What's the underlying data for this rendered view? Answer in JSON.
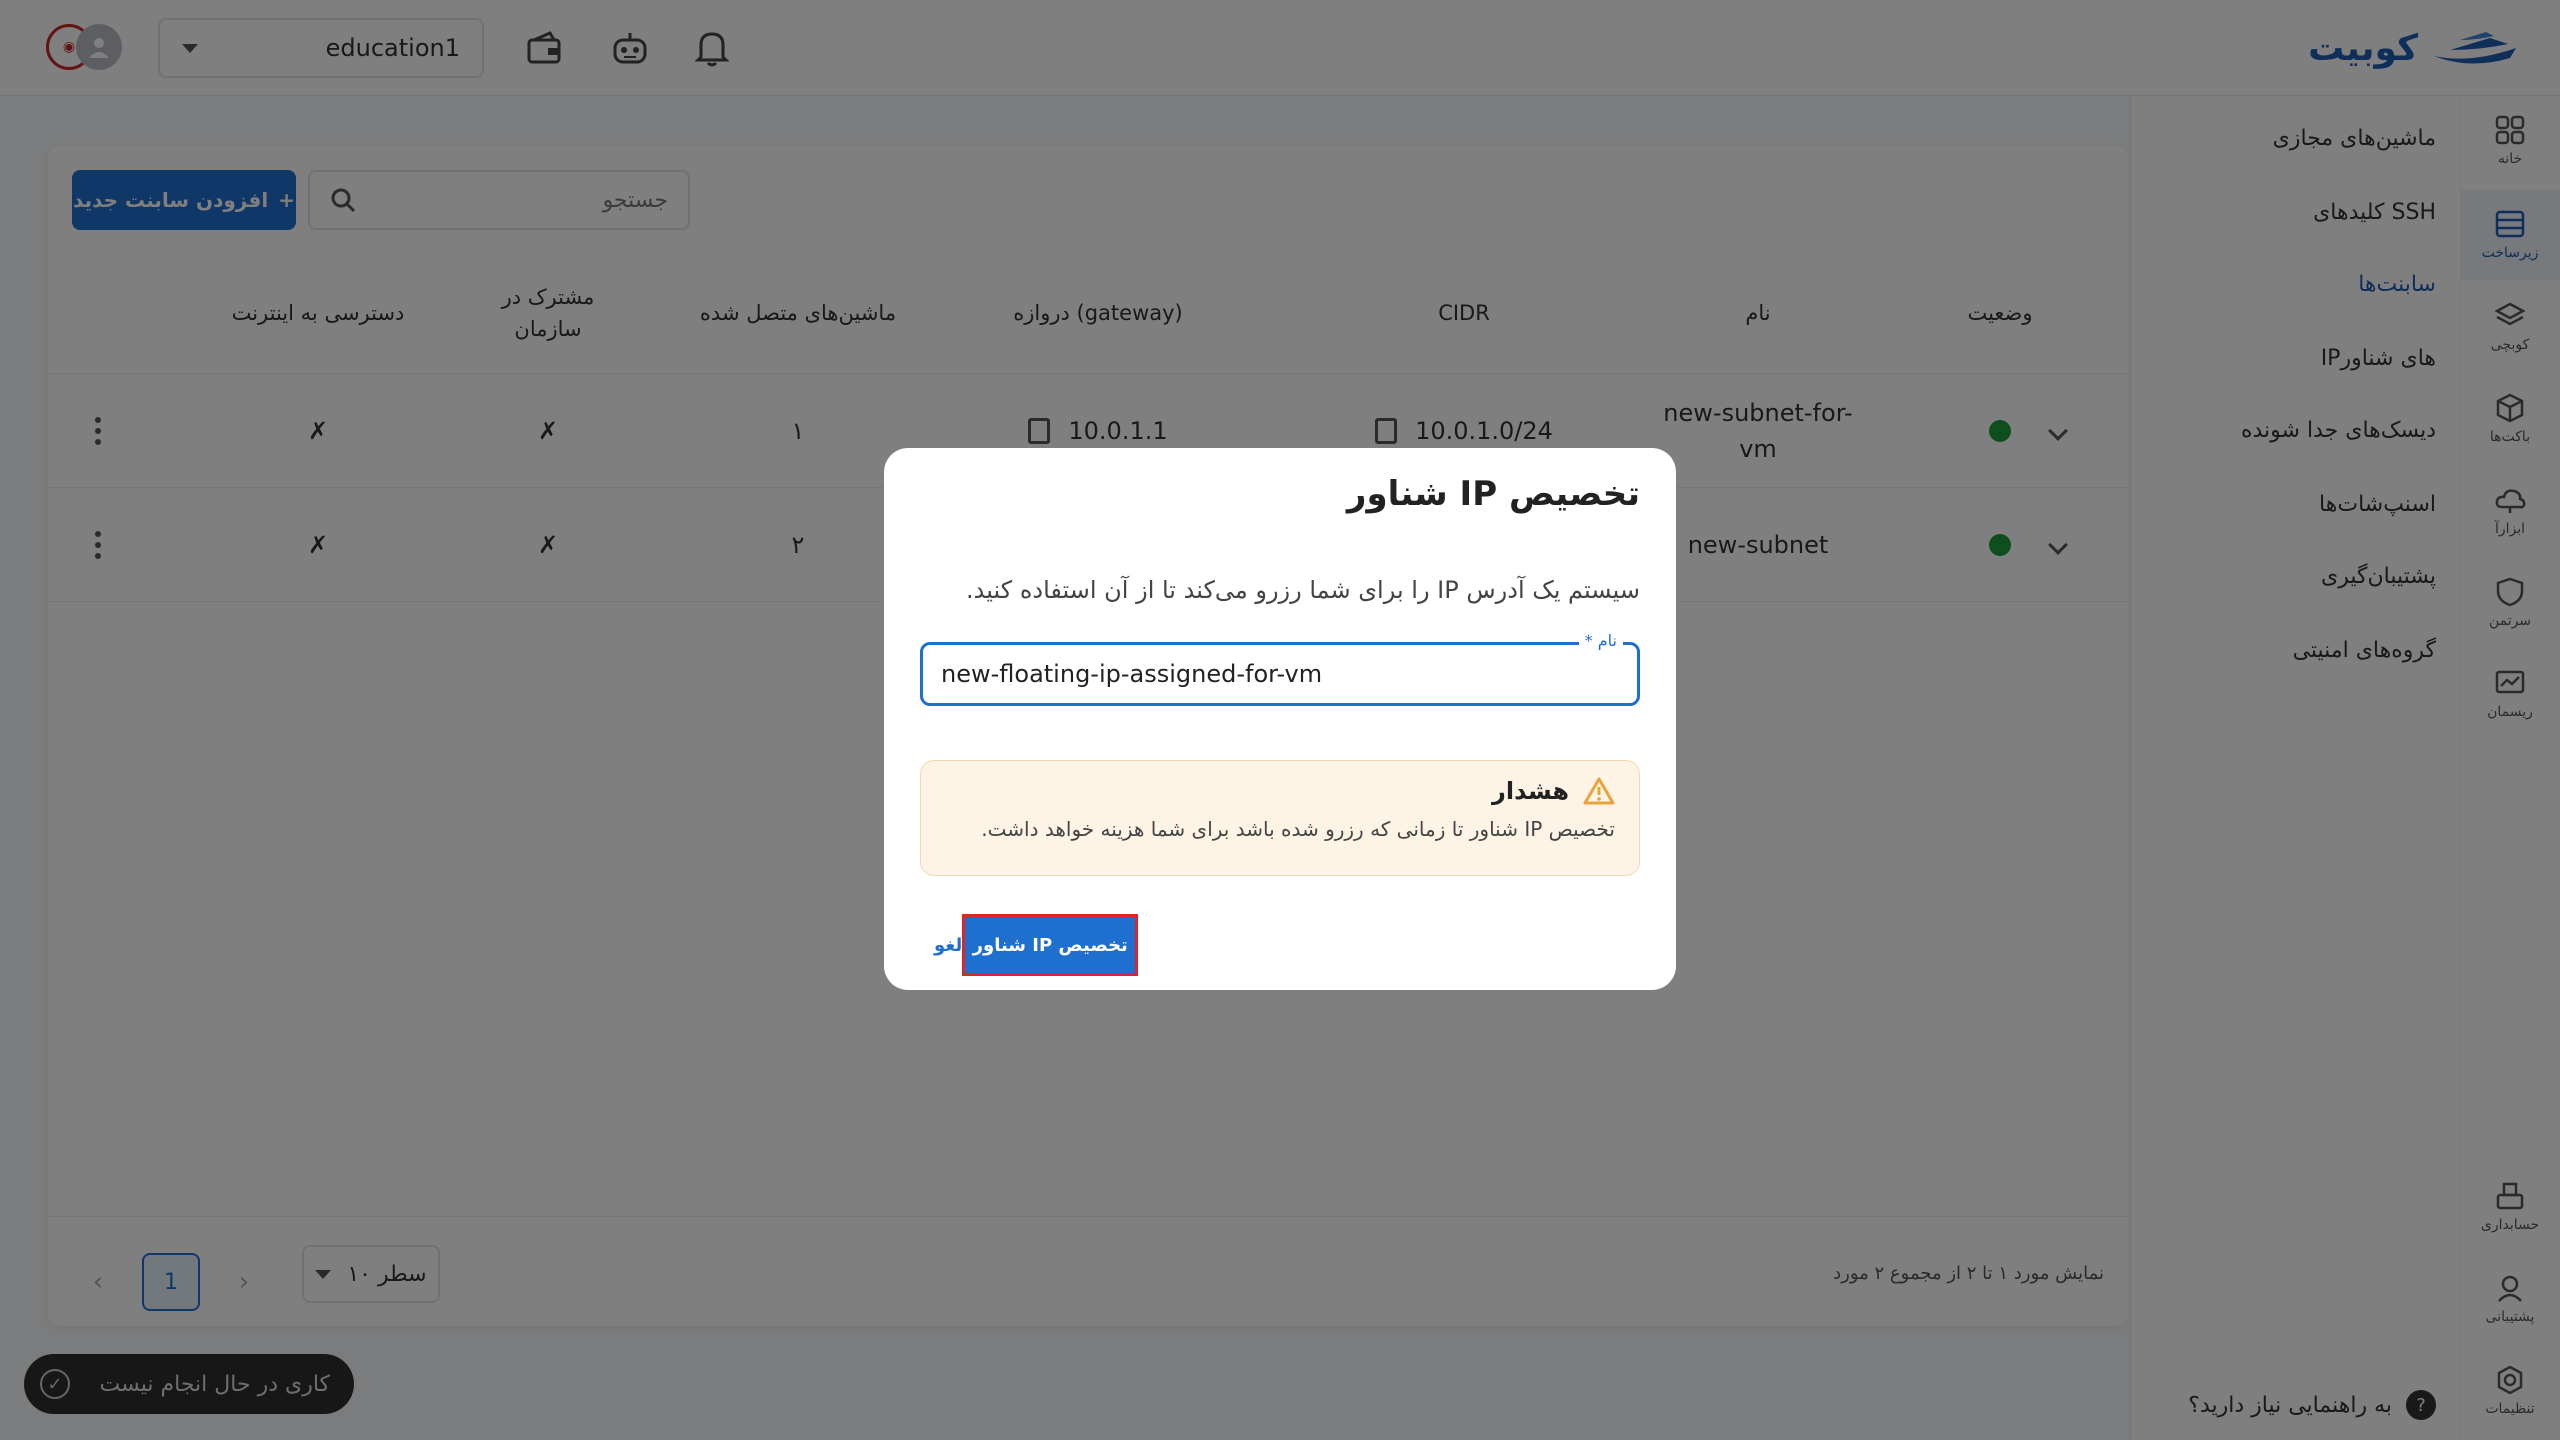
{
  "header": {
    "brand": "کوبیت",
    "project": "education1"
  },
  "rail": [
    {
      "label": "خانه",
      "icon": "grid-icon"
    },
    {
      "label": "زیرساخت",
      "icon": "server-icon",
      "active": true
    },
    {
      "label": "کوبچی",
      "icon": "layers-icon"
    },
    {
      "label": "باکت‌ها",
      "icon": "cube-icon"
    },
    {
      "label": "ابزارآ",
      "icon": "cloud-icon"
    },
    {
      "label": "سرتمن",
      "icon": "shield-icon"
    },
    {
      "label": "ریسمان",
      "icon": "chart-icon"
    },
    {
      "label": "حسابداری",
      "icon": "cash-icon"
    },
    {
      "label": "پشتیبانی",
      "icon": "support-icon"
    },
    {
      "label": "تنظیمات",
      "icon": "gear-icon"
    }
  ],
  "submenu": {
    "items": [
      "ماشین‌های مجازی",
      "کلیدهای SSH",
      "سابنت‌ها",
      "IPهای شناور",
      "دیسک‌های جدا شونده",
      "اسنپ‌شات‌ها",
      "پشتیبان‌گیری",
      "گروه‌های امنیتی"
    ],
    "active_index": 2,
    "help": "به راهنمایی نیاز دارید؟"
  },
  "main": {
    "add_button": "افزودن سابنت جدید",
    "search_placeholder": "جستجو",
    "columns": {
      "status": "وضعیت",
      "name": "نام",
      "cidr": "CIDR",
      "gateway": "دروازه (gateway)",
      "machines": "ماشین‌های متصل شده",
      "shared_line1": "مشترک در",
      "shared_line2": "سازمان",
      "internet": "دسترسی به اینترنت"
    },
    "rows": [
      {
        "name_line1": "new-subnet-for-",
        "name_line2": "vm",
        "cidr": "10.0.1.0/24",
        "gateway": "10.0.1.1",
        "machines": "۱",
        "shared": "✗",
        "internet": "✗"
      },
      {
        "name_line1": "new-subnet",
        "name_line2": "",
        "cidr": "",
        "gateway": "",
        "machines": "۲",
        "shared": "✗",
        "internet": "✗"
      }
    ],
    "pagination": {
      "page": "1",
      "rows_per_page": "۱۰ سطر",
      "range_info": "نمایش مورد ۱ تا ۲ از مجموع ۲ مورد"
    }
  },
  "toast": "کاری در حال انجام نیست",
  "dialog": {
    "title": "تخصیص IP شناور",
    "description": "سیستم یک آدرس IP را برای شما رزرو می‌کند تا از آن استفاده کنید.",
    "field_label": "نام *",
    "field_value": "new-floating-ip-assigned-for-vm",
    "warning_title": "هشدار",
    "warning_text": "تخصیص IP شناور تا زمانی که رزرو شده باشد برای شما هزینه خواهد داشت.",
    "submit": "تخصیص IP شناور",
    "cancel": "لغو"
  }
}
